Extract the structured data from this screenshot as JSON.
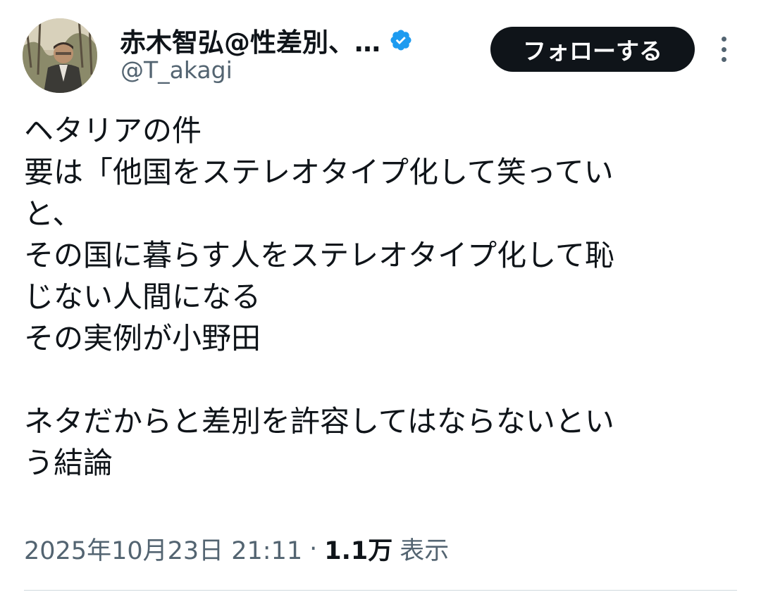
{
  "author": {
    "display_name": "赤木智弘@性差別、…",
    "handle": "@T_akagi",
    "verified": true,
    "verified_color": "#1d9bf0"
  },
  "follow_button": {
    "label": "フォローする"
  },
  "tweet": {
    "lines": [
      "ヘタリアの件",
      "要は「他国をステレオタイプ化して笑ってい",
      "と、",
      "その国に暮らす人をステレオタイプ化して恥",
      "じない人間になる",
      "その実例が小野田",
      "",
      "ネタだからと差別を許容してはならないとい",
      "う結論"
    ]
  },
  "meta": {
    "timestamp": "2025年10月23日 21:11",
    "separator": "·",
    "views_count": "1.1万",
    "views_label": "表示"
  }
}
